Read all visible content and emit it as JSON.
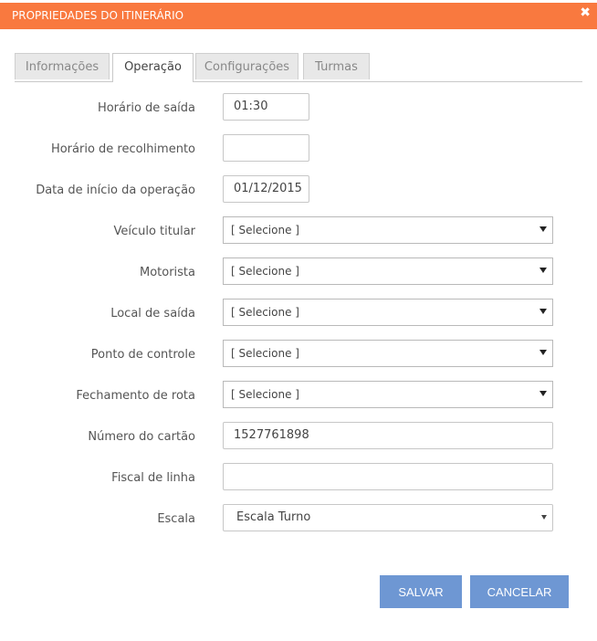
{
  "dialog": {
    "title": "PROPRIEDADES DO ITINERÁRIO",
    "close_glyph": "✖"
  },
  "tabs": [
    {
      "label": "Informações",
      "active": false
    },
    {
      "label": "Operação",
      "active": true
    },
    {
      "label": "Configurações",
      "active": false
    },
    {
      "label": "Turmas",
      "active": false
    }
  ],
  "form": {
    "horario_saida": {
      "label": "Horário de saída",
      "value": "01:30"
    },
    "horario_recolhimento": {
      "label": "Horário de recolhimento",
      "value": ""
    },
    "data_inicio": {
      "label": "Data de início da operação",
      "value": "01/12/2015"
    },
    "veiculo_titular": {
      "label": "Veículo titular",
      "value": "[ Selecione ]"
    },
    "motorista": {
      "label": "Motorista",
      "value": "[ Selecione ]"
    },
    "local_saida": {
      "label": "Local de saída",
      "value": "[ Selecione ]"
    },
    "ponto_controle": {
      "label": "Ponto de controle",
      "value": "[ Selecione ]"
    },
    "fechamento_rota": {
      "label": "Fechamento de rota",
      "value": "[ Selecione ]"
    },
    "numero_cartao": {
      "label": "Número do cartão",
      "value": "1527761898"
    },
    "fiscal_linha": {
      "label": "Fiscal de linha",
      "value": ""
    },
    "escala": {
      "label": "Escala",
      "value": "Escala Turno"
    }
  },
  "buttons": {
    "save": "SALVAR",
    "cancel": "CANCELAR"
  },
  "colors": {
    "header": "#f9793f",
    "button": "#6e97d3"
  }
}
